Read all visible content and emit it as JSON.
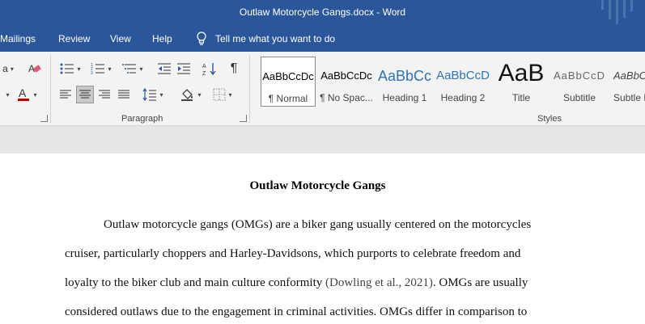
{
  "window": {
    "title": "Outlaw Motorcycle Gangs.docx  -  Word"
  },
  "menu": {
    "items": [
      "Mailings",
      "Review",
      "View",
      "Help"
    ],
    "tell_me": "Tell me what you want to do"
  },
  "ribbon": {
    "groups": {
      "paragraph": "Paragraph",
      "styles": "Styles"
    },
    "styles": [
      {
        "sample": "AaBbCcDc",
        "name": "¶ Normal",
        "selected": true
      },
      {
        "sample": "AaBbCcDc",
        "name": "¶ No Spac..."
      },
      {
        "sample": "AaBbCc",
        "name": "Heading 1"
      },
      {
        "sample": "AaBbCcD",
        "name": "Heading 2"
      },
      {
        "sample": "AaB",
        "name": "Title"
      },
      {
        "sample": "AaBbCcD",
        "name": "Subtitle"
      },
      {
        "sample": "AaBbCcD",
        "name": "Subtle E"
      }
    ],
    "colors": {
      "font_color": "#c00000",
      "accent": "#2b579a"
    }
  },
  "document": {
    "heading": "Outlaw Motorcycle Gangs",
    "line1": "Outlaw motorcycle gangs (OMGs) are a biker gang usually centered on the motorcycles",
    "line2": "cruiser, particularly choppers and Harley-Davidsons, which purports to celebrate freedom and",
    "line3_pre": "loyalty to the biker club and main culture conformity ",
    "line3_cite": "(Dowling et al., 2021)",
    "line3_post": ".  OMGs are usually",
    "line4": "considered outlaws due to the engagement in criminal activities. OMGs differ in comparison to"
  }
}
